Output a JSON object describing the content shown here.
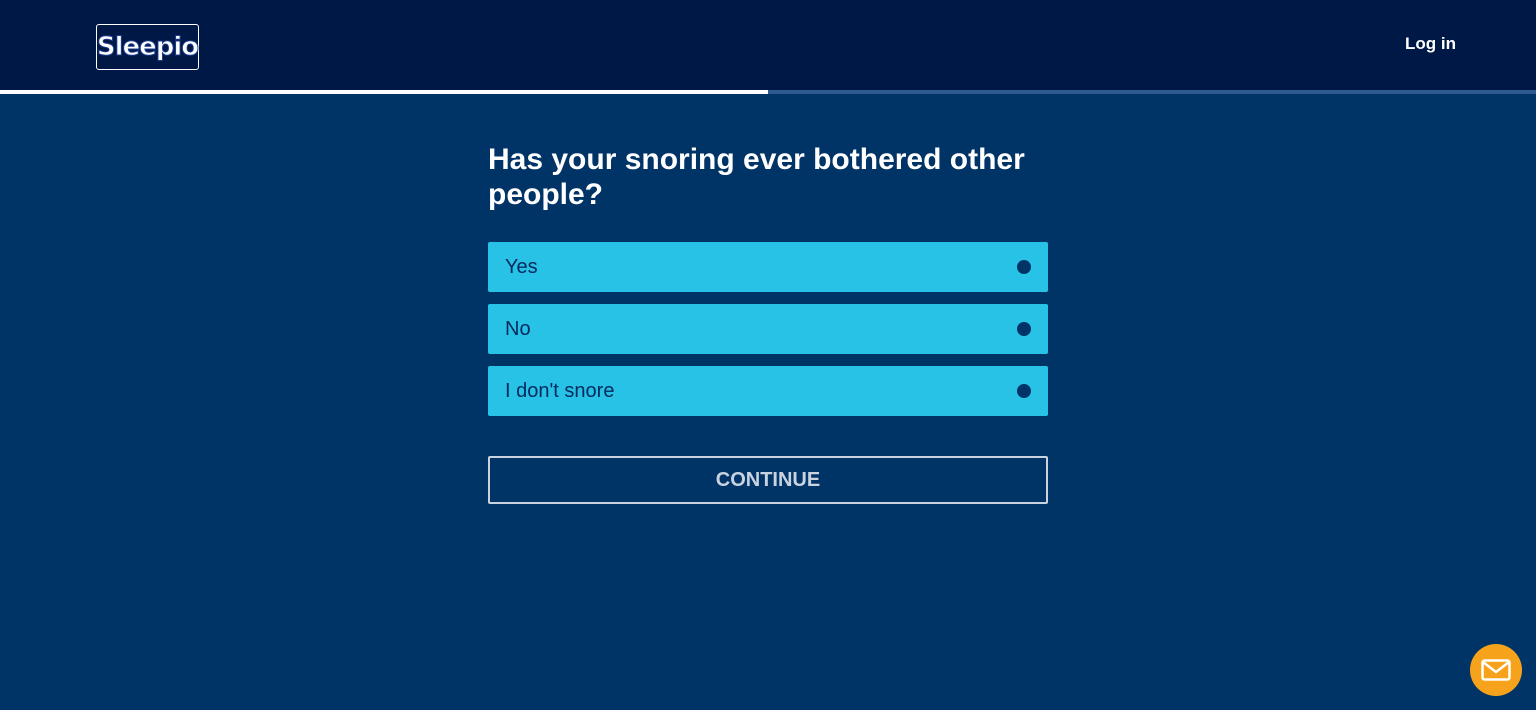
{
  "header": {
    "logo_text": "Sleepio",
    "login_label": "Log in"
  },
  "progress": {
    "fraction": 0.5
  },
  "question": {
    "title": "Has your snoring ever bothered other people?"
  },
  "options": [
    {
      "label": "Yes"
    },
    {
      "label": "No"
    },
    {
      "label": "I don't snore"
    }
  ],
  "continue_label": "CONTINUE",
  "colors": {
    "background": "#003366",
    "header": "#001845",
    "option": "#29c2e7",
    "chat": "#f7a21b"
  },
  "icons": {
    "chat": "mail-icon"
  }
}
